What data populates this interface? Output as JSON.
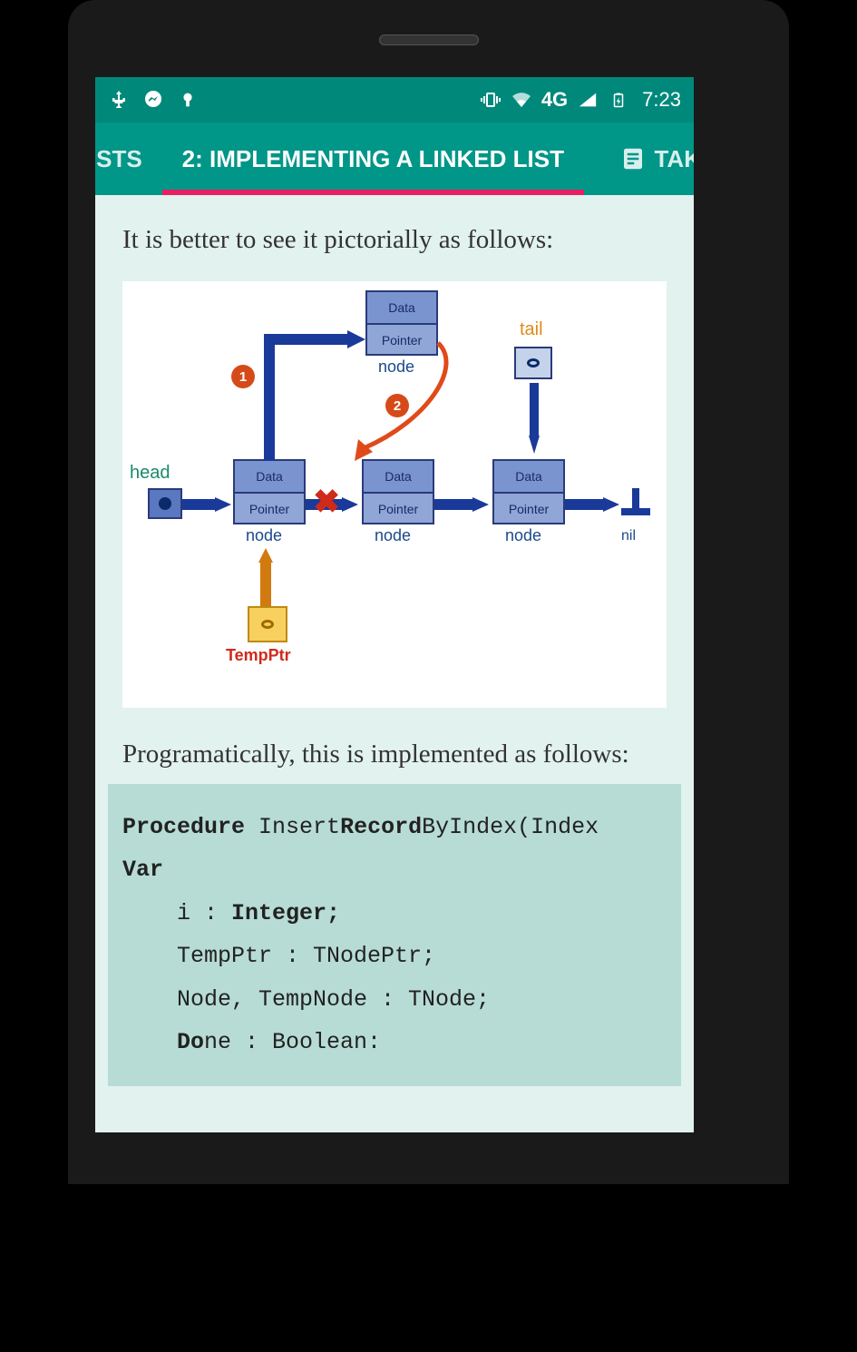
{
  "statusbar": {
    "time": "7:23",
    "network": "4G"
  },
  "tabs": {
    "left_partial": "D LISTS",
    "active": "2: IMPLEMENTING A LINKED LIST",
    "right_partial": "TAK"
  },
  "content": {
    "intro": "It is better to see it pictorially as follows:",
    "second": "Programatically, this is implemented as follows:"
  },
  "diagram": {
    "head": "head",
    "tail": "tail",
    "node": "node",
    "data": "Data",
    "pointer": "Pointer",
    "nil": "nil",
    "tempptr": "TempPtr",
    "step1": "1",
    "step2": "2"
  },
  "code": {
    "l1a": "Procedure",
    "l1b": " Insert",
    "l1c": "Record",
    "l1d": "ByIndex(Index",
    "l2": "Var",
    "l3a": "i : ",
    "l3b": "Integer;",
    "l4": "TempPtr : TNodePtr;",
    "l5": "Node, TempNode : TNode;",
    "l6a": "Do",
    "l6b": "ne : Boolean:"
  }
}
